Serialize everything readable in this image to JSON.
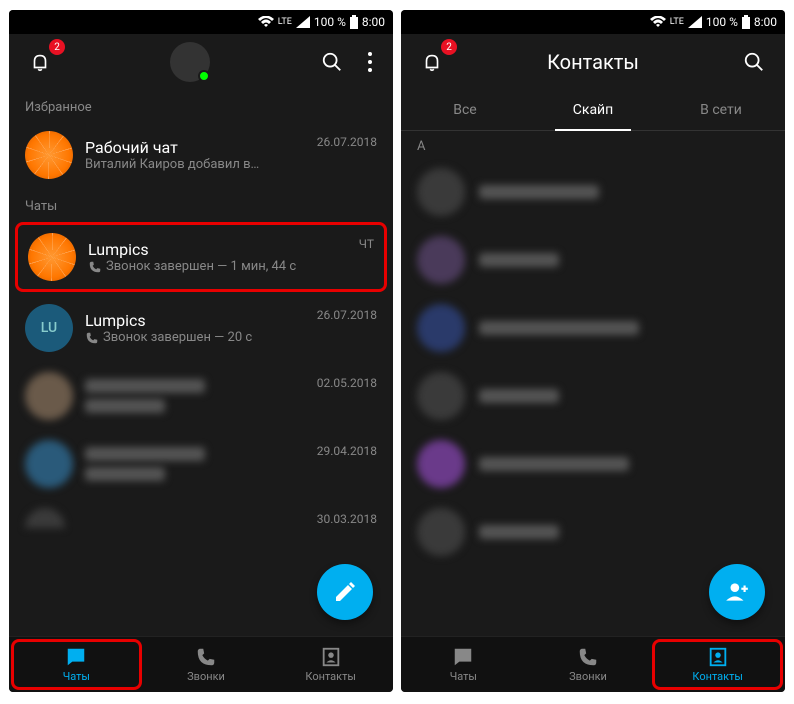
{
  "status": {
    "lte": "LTE",
    "battery": "100 %",
    "time": "8:00"
  },
  "left": {
    "notif_badge": "2",
    "sections": {
      "favorites": "Избранное",
      "chats": "Чаты"
    },
    "chats": [
      {
        "title": "Рабочий чат",
        "sub": "Виталий  Каиров добавил в…",
        "meta": "26.07.2018"
      },
      {
        "title": "Lumpics",
        "sub": "Звонок завершен — 1 мин, 44 с",
        "meta": "ЧТ"
      },
      {
        "title": "Lumpics",
        "sub": "Звонок завершен — 20 с",
        "meta": "26.07.2018"
      },
      {
        "title": "",
        "sub": "",
        "meta": "02.05.2018"
      },
      {
        "title": "",
        "sub": "",
        "meta": "29.04.2018"
      },
      {
        "title": "",
        "sub": "",
        "meta": "30.03.2018"
      }
    ],
    "nav": {
      "chats": "Чаты",
      "calls": "Звонки",
      "contacts": "Контакты"
    }
  },
  "right": {
    "notif_badge": "2",
    "title": "Контакты",
    "tabs": {
      "all": "Все",
      "skype": "Скайп",
      "online": "В сети"
    },
    "letter": "A",
    "nav": {
      "chats": "Чаты",
      "calls": "Звонки",
      "contacts": "Контакты"
    }
  }
}
